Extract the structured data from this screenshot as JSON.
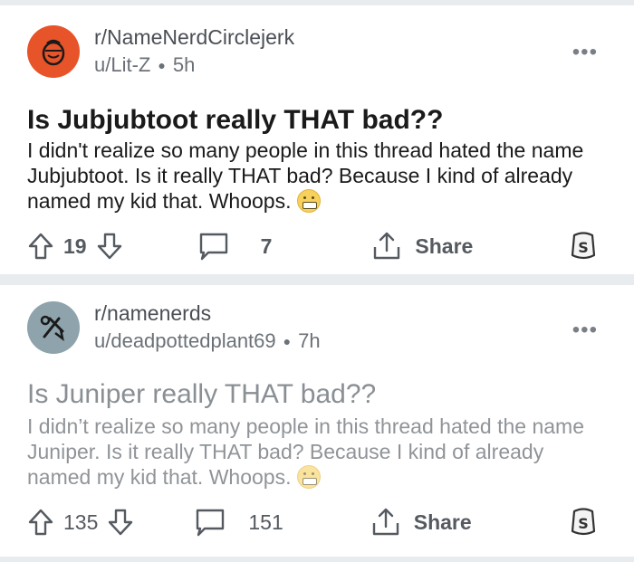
{
  "posts": [
    {
      "subreddit": "r/NameNerdCirclejerk",
      "user": "u/Lit-Z",
      "age": "5h",
      "title": "Is Jubjubtoot really THAT bad??",
      "body": "I didn't realize so many people in this thread hated the name  Jubjubtoot. Is it really THAT bad? Because I kind of already named my kid that. Whoops.",
      "votes": "19",
      "comments": "7",
      "share_label": "Share",
      "avatar_color": "#e8542a"
    },
    {
      "subreddit": "r/namenerds",
      "user": "u/deadpottedplant69",
      "age": "7h",
      "title": "Is Juniper really THAT bad??",
      "body": "I didn’t realize so many people in this thread hated the name Juniper. Is it really THAT bad? Because I kind of already named my kid that. Whoops.",
      "votes": "135",
      "comments": "151",
      "share_label": "Share",
      "avatar_color": "#8ea3ab"
    }
  ],
  "icons": {
    "more": "more-options-icon",
    "upvote": "upvote-arrow-icon",
    "downvote": "downvote-arrow-icon",
    "comment": "comment-bubble-icon",
    "share": "share-icon",
    "award": "award-icon",
    "emoji": "grimacing-face-emoji-icon"
  },
  "more_glyph": "•••"
}
